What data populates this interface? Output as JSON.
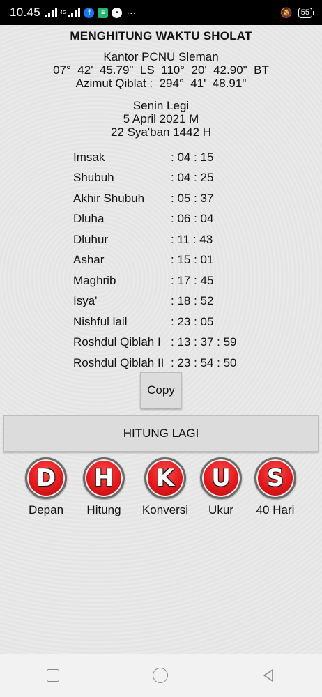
{
  "status": {
    "time": "10.45",
    "network_small": "4G",
    "battery": "55"
  },
  "header": {
    "title": "MENGHITUNG WAKTU SHOLAT"
  },
  "location": {
    "name": "Kantor PCNU Sleman",
    "coordinates": "07°  42'  45.79\"  LS  110°  20'  42.90\"  BT",
    "azimuth": "Azimut Qiblat :  294°  41'  48.91\""
  },
  "date": {
    "javanese_day": "Senin Legi",
    "gregorian": "5 April 2021 M",
    "hijri": "22 Sya'ban 1442 H"
  },
  "prayer_times": [
    {
      "label": "Imsak",
      "value": ": 04 : 15"
    },
    {
      "label": "Shubuh",
      "value": ": 04 : 25"
    },
    {
      "label": "Akhir Shubuh",
      "value": ": 05 : 37"
    },
    {
      "label": "Dluha",
      "value": ": 06 : 04"
    },
    {
      "label": "Dluhur",
      "value": ": 11 : 43"
    },
    {
      "label": "Ashar",
      "value": ": 15 : 01"
    },
    {
      "label": "Maghrib",
      "value": ": 17 : 45"
    },
    {
      "label": "Isya'",
      "value": ": 18 : 52"
    },
    {
      "label": "Nishful lail",
      "value": ": 23 : 05"
    },
    {
      "label": "Roshdul Qiblah I",
      "value": ": 13 : 37 : 59"
    },
    {
      "label": "Roshdul Qiblah II",
      "value": ": 23 : 54 : 50"
    }
  ],
  "buttons": {
    "copy": "Copy",
    "hitung_lagi": "HITUNG LAGI"
  },
  "nav": [
    {
      "letter": "D",
      "label": "Depan"
    },
    {
      "letter": "H",
      "label": "Hitung"
    },
    {
      "letter": "K",
      "label": "Konversi"
    },
    {
      "letter": "U",
      "label": "Ukur"
    },
    {
      "letter": "S",
      "label": "40 Hari"
    }
  ],
  "colors": {
    "nav_circle": "#e0181b",
    "status_bar": "#000000"
  }
}
